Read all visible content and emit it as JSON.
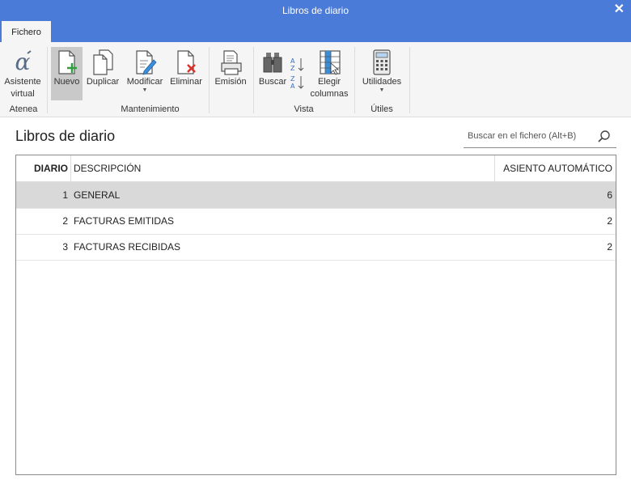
{
  "window": {
    "title": "Libros de diario",
    "close_glyph": "✕"
  },
  "tabs": [
    {
      "label": "Fichero"
    }
  ],
  "ribbon": {
    "groups": [
      {
        "label": "Atenea"
      },
      {
        "label": "Mantenimiento"
      },
      {
        "label": "Vista"
      },
      {
        "label": "Útiles"
      }
    ],
    "buttons": {
      "asistente": {
        "line1": "Asistente",
        "line2": "virtual",
        "icon": "alpha-icon"
      },
      "nuevo": {
        "label": "Nuevo",
        "icon": "new-document-icon"
      },
      "duplicar": {
        "label": "Duplicar",
        "icon": "duplicate-icon"
      },
      "modificar": {
        "label": "Modificar",
        "icon": "edit-document-icon"
      },
      "eliminar": {
        "label": "Eliminar",
        "icon": "delete-document-icon"
      },
      "emision": {
        "label": "Emisión",
        "icon": "print-icon"
      },
      "buscar": {
        "label": "Buscar",
        "icon": "binoculars-icon"
      },
      "ordenar": {
        "icon": "sort-az-icon"
      },
      "elegir": {
        "line1": "Elegir",
        "line2": "columnas",
        "icon": "columns-icon"
      },
      "utilidades": {
        "label": "Utilidades",
        "icon": "calculator-icon"
      }
    }
  },
  "main": {
    "heading": "Libros de diario",
    "search": {
      "placeholder": "Buscar en el fichero (Alt+B)",
      "icon": "search-icon"
    }
  },
  "table": {
    "columns": [
      "DIARIO",
      "DESCRIPCIÓN",
      "ASIENTO AUTOMÁTICO"
    ],
    "rows": [
      {
        "diario": "1",
        "descripcion": "GENERAL",
        "asiento": "6"
      },
      {
        "diario": "2",
        "descripcion": "FACTURAS EMITIDAS",
        "asiento": "2"
      },
      {
        "diario": "3",
        "descripcion": "FACTURAS RECIBIDAS",
        "asiento": "2"
      }
    ],
    "selected_row": 0
  },
  "colors": {
    "titlebar": "#4a7bd9",
    "ribbon_bg": "#f5f5f5",
    "selected_row": "#d9d9d9"
  }
}
